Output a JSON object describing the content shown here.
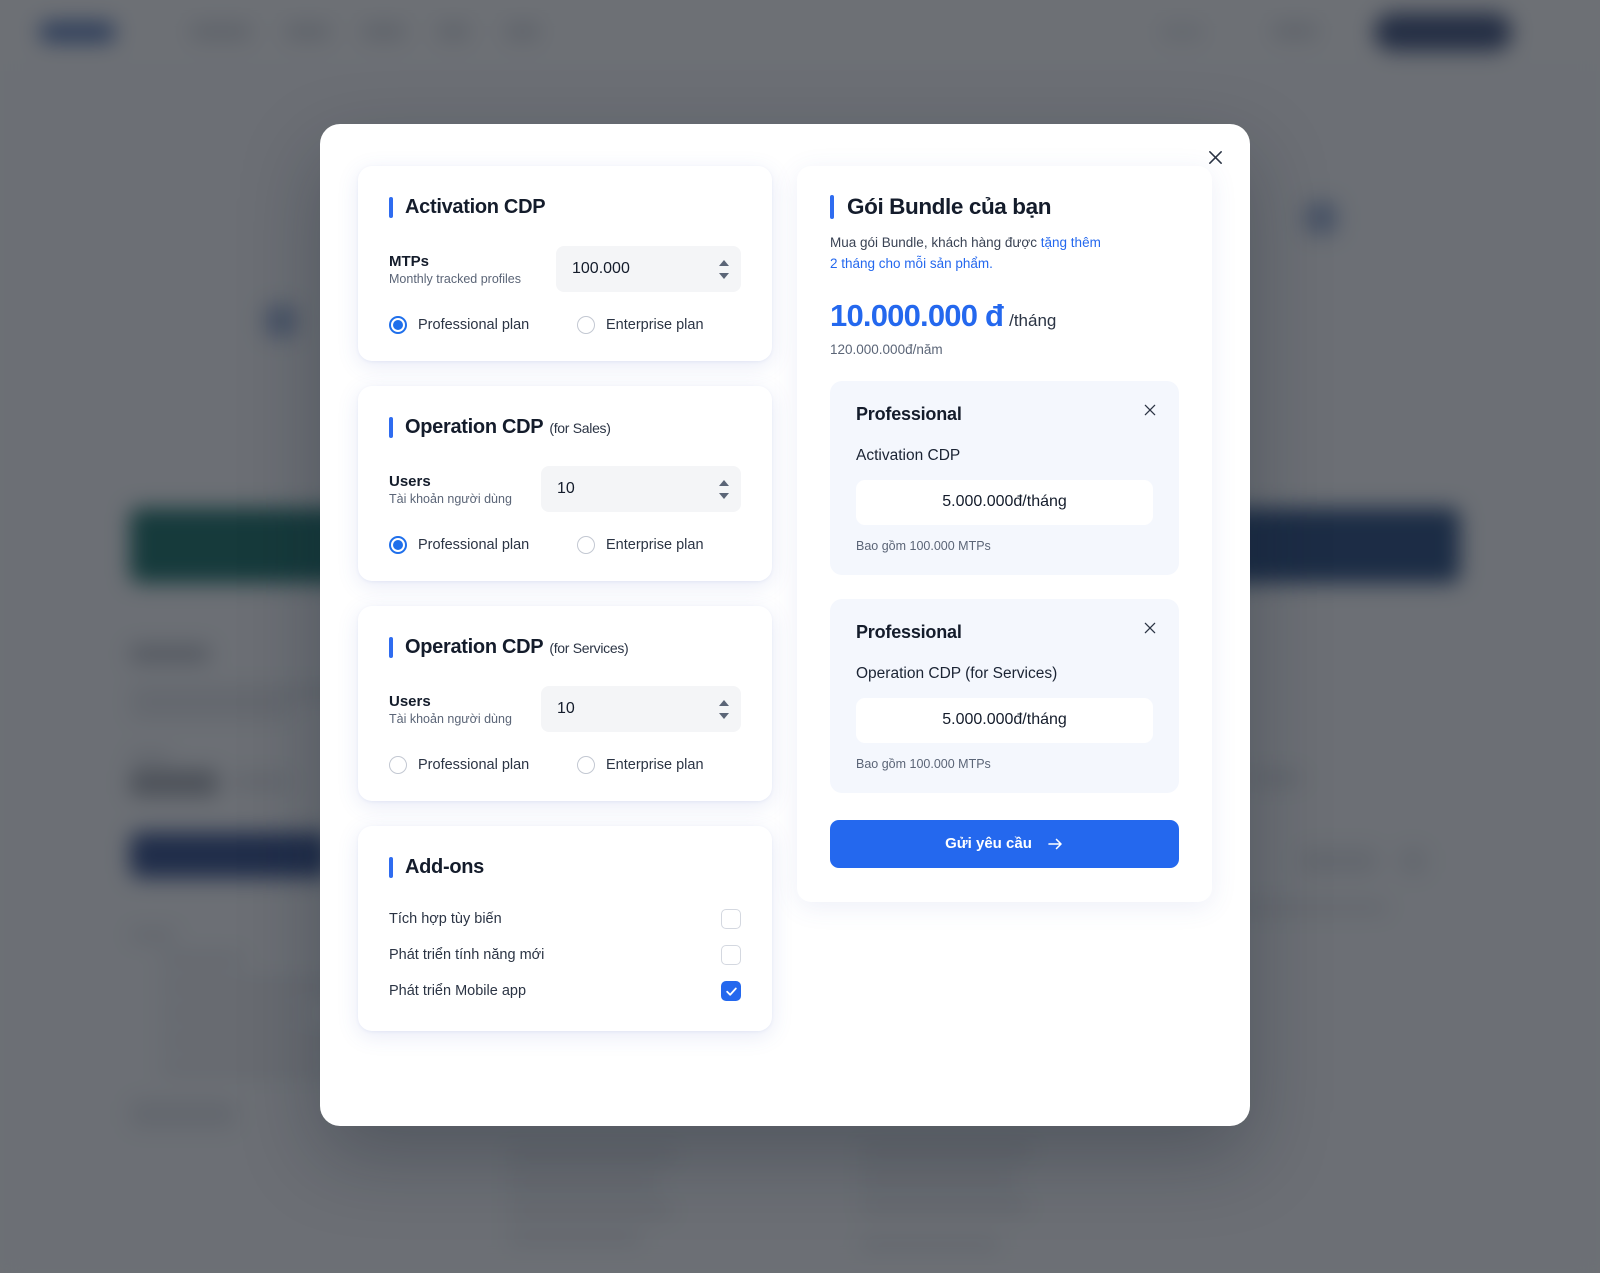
{
  "background": {
    "nav_items": [
      "Solutions",
      "Platform",
      "Pricing",
      "Partner",
      "Blog",
      "About"
    ],
    "cta_label": "Request demo"
  },
  "modal": {
    "close_icon": "close-icon",
    "products": [
      {
        "title": "Activation CDP",
        "title_suffix": "",
        "field_label": "MTPs",
        "field_sub": "Monthly tracked profiles",
        "value": "100.000",
        "options": [
          {
            "label": "Professional plan",
            "selected": true
          },
          {
            "label": "Enterprise plan",
            "selected": false
          }
        ]
      },
      {
        "title": "Operation CDP",
        "title_suffix": "(for Sales)",
        "field_label": "Users",
        "field_sub": "Tài khoản người dùng",
        "value": "10",
        "options": [
          {
            "label": "Professional plan",
            "selected": true
          },
          {
            "label": "Enterprise plan",
            "selected": false
          }
        ]
      },
      {
        "title": "Operation CDP",
        "title_suffix": "(for Services)",
        "field_label": "Users",
        "field_sub": "Tài khoản người dùng",
        "value": "10",
        "options": [
          {
            "label": "Professional plan",
            "selected": false
          },
          {
            "label": "Enterprise plan",
            "selected": false
          }
        ]
      }
    ],
    "addons": {
      "title": "Add-ons",
      "items": [
        {
          "label": "Tích hợp tùy biến",
          "checked": false
        },
        {
          "label": "Phát triển tính năng mới",
          "checked": false
        },
        {
          "label": "Phát triển Mobile app",
          "checked": true
        }
      ]
    },
    "summary": {
      "title": "Gói Bundle của bạn",
      "note_plain": "Mua gói Bundle, khách hàng được ",
      "note_highlight_1": "tặng thêm",
      "note_highlight_2": "2 tháng cho mỗi sản phẩm.",
      "price_main": "10.000.000 đ",
      "price_per": "/tháng",
      "price_year": "120.000.000đ/năm",
      "cards": [
        {
          "plan": "Professional",
          "product": "Activation CDP",
          "price": "5.000.000đ/tháng",
          "included": "Bao gồm 100.000 MTPs",
          "remove_icon": "close-icon"
        },
        {
          "plan": "Professional",
          "product": "Operation CDP (for Services)",
          "price": "5.000.000đ/tháng",
          "included": "Bao gồm 100.000 MTPs",
          "remove_icon": "close-icon"
        }
      ],
      "submit_label": "Gửi yêu cầu",
      "submit_icon": "arrow-right-icon"
    }
  },
  "colors": {
    "accent_blue": "#2468ee",
    "radio_blue": "#1f6feb",
    "title_dark": "#141c2b",
    "card_bg": "#f4f7fd",
    "input_bg": "#f4f5f7",
    "teal": "#006157",
    "navy": "#1d3b80"
  }
}
